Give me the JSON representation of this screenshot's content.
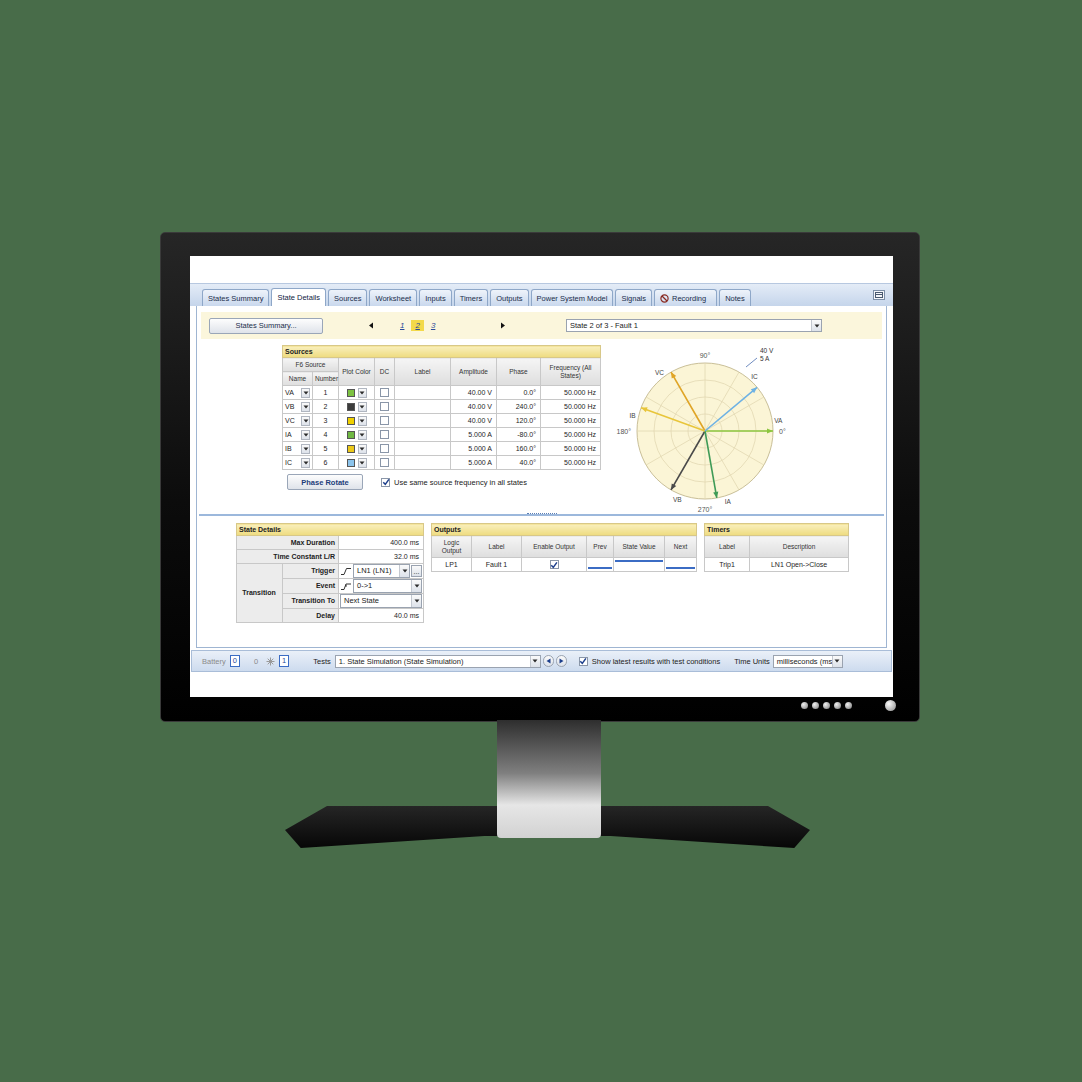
{
  "tabs": [
    {
      "label": "States Summary",
      "selected": false,
      "kind": "plain"
    },
    {
      "label": "State Details",
      "selected": true,
      "kind": "plain"
    },
    {
      "label": "Sources",
      "selected": false,
      "kind": "plain"
    },
    {
      "label": "Worksheet",
      "selected": false,
      "kind": "plain"
    },
    {
      "label": "Inputs",
      "selected": false,
      "kind": "plain"
    },
    {
      "label": "Timers",
      "selected": false,
      "kind": "plain"
    },
    {
      "label": "Outputs",
      "selected": false,
      "kind": "plain"
    },
    {
      "label": "Power System Model",
      "selected": false,
      "kind": "plain"
    },
    {
      "label": "Signals",
      "selected": false,
      "kind": "plain"
    },
    {
      "label": "Recording",
      "selected": false,
      "kind": "icon"
    },
    {
      "label": "Notes",
      "selected": false,
      "kind": "plain"
    }
  ],
  "toolbar": {
    "summary_button": "States Summary...",
    "pages": [
      {
        "label": "1",
        "selected": false
      },
      {
        "label": "2",
        "selected": true
      },
      {
        "label": "3",
        "selected": false
      }
    ],
    "state_select": "State 2 of 3 - Fault 1"
  },
  "sources": {
    "title": "Sources",
    "group": "F6 Source",
    "columns": {
      "name": "Name",
      "number": "Number",
      "color": "Plot Color",
      "dc": "DC",
      "label": "Label",
      "amplitude": "Amplitude",
      "phase": "Phase",
      "frequency": "Frequency (All States)"
    },
    "rows": [
      {
        "name": "VA",
        "number": "1",
        "color": "#7dc242",
        "dc": false,
        "label": "",
        "amplitude": "40.00 V",
        "phase": "0.0°",
        "frequency": "50.000 Hz"
      },
      {
        "name": "VB",
        "number": "2",
        "color": "#3c3c3c",
        "dc": false,
        "label": "",
        "amplitude": "40.00 V",
        "phase": "240.0°",
        "frequency": "50.000 Hz"
      },
      {
        "name": "VC",
        "number": "3",
        "color": "#f0d000",
        "dc": false,
        "label": "",
        "amplitude": "40.00 V",
        "phase": "120.0°",
        "frequency": "50.000 Hz"
      },
      {
        "name": "IA",
        "number": "4",
        "color": "#6fb843",
        "dc": false,
        "label": "",
        "amplitude": "5.000 A",
        "phase": "-80.0°",
        "frequency": "50.000 Hz"
      },
      {
        "name": "IB",
        "number": "5",
        "color": "#ecc919",
        "dc": false,
        "label": "",
        "amplitude": "5.000 A",
        "phase": "160.0°",
        "frequency": "50.000 Hz"
      },
      {
        "name": "IC",
        "number": "6",
        "color": "#8cc4ec",
        "dc": false,
        "label": "",
        "amplitude": "5.000 A",
        "phase": "40.0°",
        "frequency": "50.000 Hz"
      }
    ]
  },
  "phase_rotate": "Phase Rotate",
  "same_frequency": {
    "label": "Use same source frequency in all states",
    "checked": true
  },
  "phasor": {
    "angle_labels": [
      {
        "text": "90°",
        "angle": 90
      },
      {
        "text": "180°",
        "angle": 180
      },
      {
        "text": "270°",
        "angle": 270
      },
      {
        "text": "0°",
        "angle": 0
      }
    ],
    "scale": [
      "40 V",
      "5 A"
    ],
    "vectors": [
      {
        "label": "VA",
        "angle": 0,
        "level": 1,
        "color": "#8cc63f"
      },
      {
        "label": "VB",
        "angle": 240,
        "level": 1,
        "color": "#4a4a4a"
      },
      {
        "label": "VC",
        "angle": 120,
        "level": 1,
        "color": "#e0a526"
      },
      {
        "label": "IA",
        "angle": -80,
        "level": 1,
        "color": "#3f9b57"
      },
      {
        "label": "IB",
        "angle": 160,
        "level": 1,
        "color": "#e8c53a"
      },
      {
        "label": "IC",
        "angle": 40,
        "level": 1,
        "color": "#6eb2e4"
      }
    ]
  },
  "state_details": {
    "title": "State Details",
    "rows": [
      {
        "label": "Max Duration",
        "value": "400.0 ms"
      },
      {
        "label": "Time Constant L/R",
        "value": "32.0 ms"
      }
    ],
    "transition": {
      "label": "Transition",
      "more_button": "...",
      "rows": [
        {
          "label": "Trigger",
          "value": "LN1 (LN1)",
          "kind": "trigger"
        },
        {
          "label": "Event",
          "value": "0->1",
          "kind": "event"
        },
        {
          "label": "Transition To",
          "value": "Next State",
          "kind": "select"
        },
        {
          "label": "Delay",
          "value": "40.0 ms",
          "kind": "text"
        }
      ]
    }
  },
  "outputs": {
    "title": "Outputs",
    "columns": [
      "Logic Output",
      "Label",
      "Enable Output",
      "Prev",
      "State Value",
      "Next"
    ],
    "rows": [
      {
        "logic_output": "LP1",
        "label": "Fault 1",
        "enabled": true
      }
    ]
  },
  "timers": {
    "title": "Timers",
    "columns": [
      "Label",
      "Description"
    ],
    "rows": [
      {
        "label": "Trip1",
        "description": "LN1 Open->Close"
      }
    ]
  },
  "status_bar": {
    "battery_label": "Battery",
    "battery_value": "0",
    "counter": "0",
    "counter_value": "1",
    "tests_label": "Tests",
    "test": "1. State Simulation (State Simulation)",
    "show_latest": {
      "label": "Show latest results with test conditions",
      "checked": true
    },
    "time_units_label": "Time Units",
    "time_units": "milliseconds (ms)"
  }
}
